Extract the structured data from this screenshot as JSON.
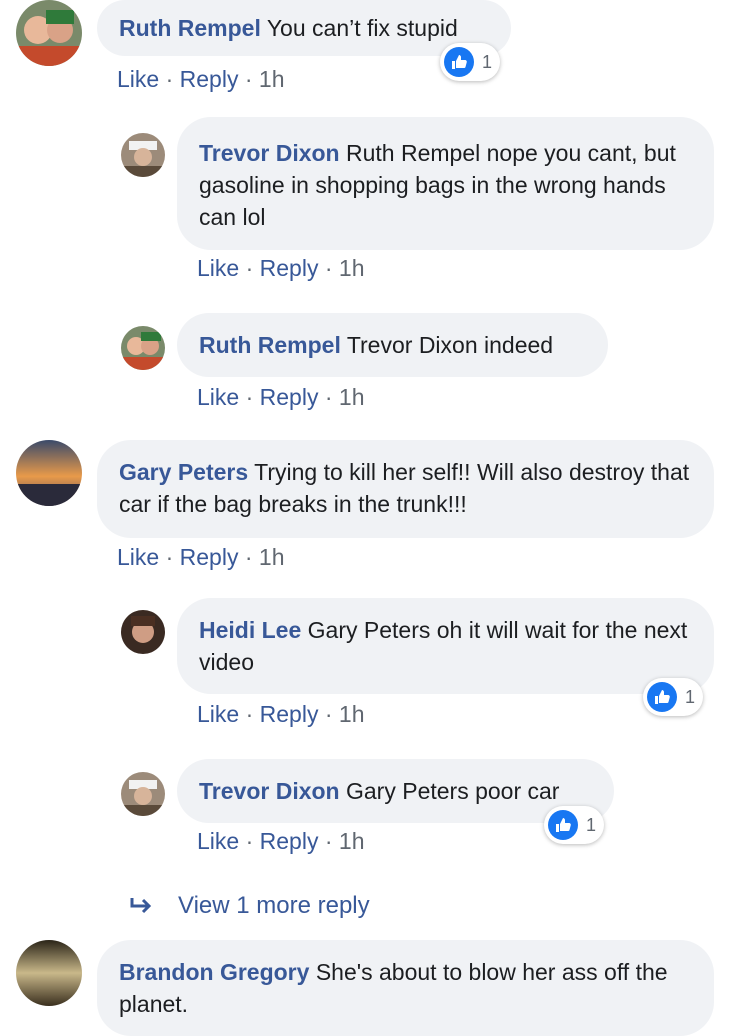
{
  "actions": {
    "like": "Like",
    "reply": "Reply",
    "separator": "·"
  },
  "comments": [
    {
      "author": "Ruth Rempel",
      "text": "You can’t fix stupid",
      "time": "1h",
      "reactions": "1"
    },
    {
      "author": "Trevor Dixon",
      "text": "Ruth Rempel nope you cant, but gasoline in shopping bags in the wrong hands can lol",
      "time": "1h"
    },
    {
      "author": "Ruth Rempel",
      "text": "Trevor Dixon indeed",
      "time": "1h"
    },
    {
      "author": "Gary Peters",
      "text": "Trying to kill her self!! Will also destroy that car if the bag breaks in the trunk!!!",
      "time": "1h"
    },
    {
      "author": "Heidi Lee",
      "text": "Gary Peters oh it will wait for the next video",
      "time": "1h",
      "reactions": "1"
    },
    {
      "author": "Trevor Dixon",
      "text": "Gary Peters poor car",
      "time": "1h",
      "reactions": "1"
    },
    {
      "author": "Brandon Gregory",
      "text": "She's about to blow her ass off the planet."
    }
  ],
  "view_more": "View 1 more reply",
  "icons": {
    "like_reaction": "thumbs-up-icon",
    "reply_arrow": "reply-arrow-icon"
  },
  "colors": {
    "link": "#385898",
    "like_blue": "#1877f2",
    "bubble": "#f0f2f5"
  }
}
